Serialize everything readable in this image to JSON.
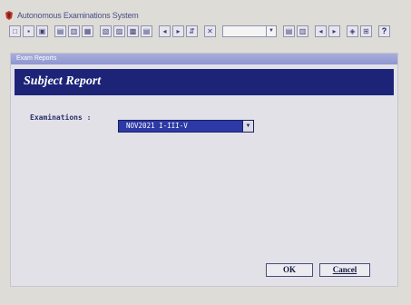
{
  "app": {
    "title": "Autonomous Examinations System",
    "icon": "app-logo-icon"
  },
  "toolbar": {
    "groups": [
      {
        "buttons": [
          "□",
          "▪",
          "▣"
        ]
      },
      {
        "buttons": [
          "▤",
          "▥",
          "▦"
        ]
      },
      {
        "buttons": [
          "▧",
          "▨",
          "▩",
          "▤"
        ]
      },
      {
        "buttons": [
          "◂",
          "▸",
          "⇵"
        ]
      },
      {
        "buttons": [
          "✕"
        ]
      }
    ],
    "combo_value": "",
    "combo_arrow": "▼",
    "right_groups": [
      {
        "buttons": [
          "▤",
          "▥"
        ]
      },
      {
        "buttons": [
          "◂",
          "▸"
        ]
      },
      {
        "buttons": [
          "◈",
          "⊞"
        ]
      }
    ],
    "help_label": "?"
  },
  "form": {
    "caption": "Exam Reports",
    "header_title": "Subject Report",
    "examinations_label": "Examinations :",
    "examinations_value": "NOV2021 I-III-V",
    "dropdown_arrow": "▼"
  },
  "buttons": {
    "ok": "OK",
    "cancel": "Cancel"
  },
  "colors": {
    "header_band": "#1d2478",
    "caption_bar": "#8e96cf",
    "select_bg": "#2d3aa6"
  }
}
